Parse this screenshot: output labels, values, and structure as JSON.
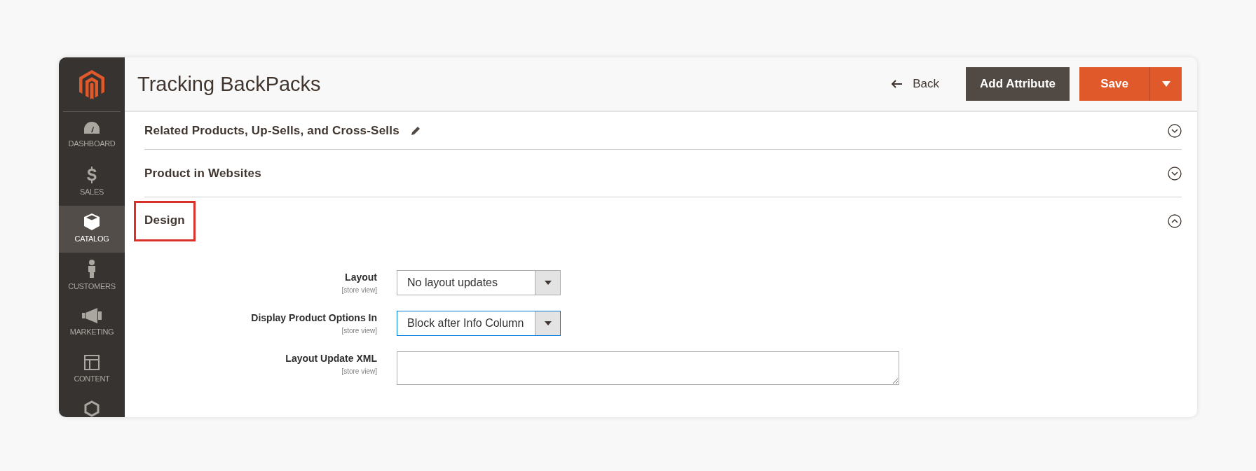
{
  "sidebar": {
    "items": [
      {
        "label": "DASHBOARD",
        "selected": false
      },
      {
        "label": "SALES",
        "selected": false
      },
      {
        "label": "CATALOG",
        "selected": true
      },
      {
        "label": "CUSTOMERS",
        "selected": false
      },
      {
        "label": "MARKETING",
        "selected": false
      },
      {
        "label": "CONTENT",
        "selected": false
      }
    ]
  },
  "header": {
    "title": "Tracking BackPacks",
    "back": "Back",
    "add_attribute": "Add Attribute",
    "save": "Save"
  },
  "sections": [
    {
      "title": "Related Products, Up-Sells, and Cross-Sells",
      "editable": true,
      "expanded": false,
      "highlighted": false
    },
    {
      "title": "Product in Websites",
      "editable": false,
      "expanded": false,
      "highlighted": false
    },
    {
      "title": "Design",
      "editable": false,
      "expanded": true,
      "highlighted": true,
      "fields": [
        {
          "kind": "select",
          "label": "Layout",
          "scope": "[store view]",
          "value": "No layout updates",
          "focused": false
        },
        {
          "kind": "select",
          "label": "Display Product Options In",
          "scope": "[store view]",
          "value": "Block after Info Column",
          "focused": true
        },
        {
          "kind": "textarea",
          "label": "Layout Update XML",
          "scope": "[store view]",
          "focused": false
        }
      ]
    }
  ]
}
